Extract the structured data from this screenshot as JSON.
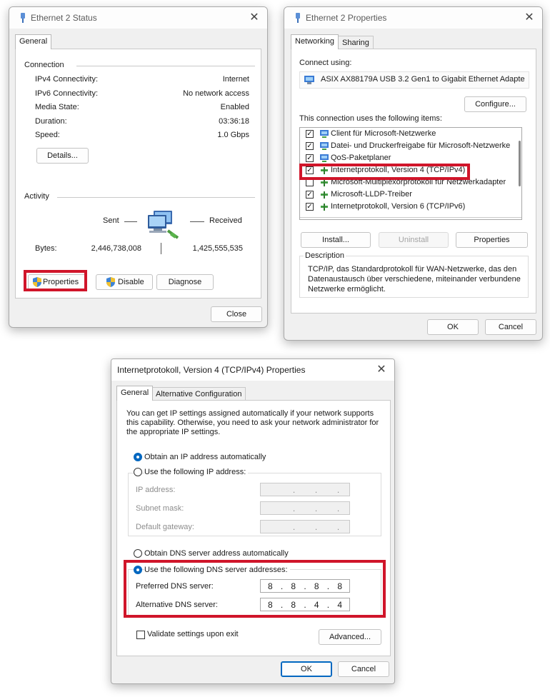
{
  "status_window": {
    "title": "Ethernet 2 Status",
    "tab_general": "General",
    "connection_heading": "Connection",
    "rows": [
      {
        "label": "IPv4 Connectivity:",
        "value": "Internet"
      },
      {
        "label": "IPv6 Connectivity:",
        "value": "No network access"
      },
      {
        "label": "Media State:",
        "value": "Enabled"
      },
      {
        "label": "Duration:",
        "value": "03:36:18"
      },
      {
        "label": "Speed:",
        "value": "1.0 Gbps"
      }
    ],
    "details_button": "Details...",
    "activity_heading": "Activity",
    "sent_label": "Sent",
    "received_label": "Received",
    "bytes_label": "Bytes:",
    "bytes_sent": "2,446,738,008",
    "bytes_received": "1,425,555,535",
    "properties_button": "Properties",
    "disable_button": "Disable",
    "diagnose_button": "Diagnose",
    "close_button": "Close"
  },
  "properties_window": {
    "title": "Ethernet 2 Properties",
    "tab_networking": "Networking",
    "tab_sharing": "Sharing",
    "connect_using_label": "Connect using:",
    "adapter_name": "ASIX AX88179A USB 3.2 Gen1 to Gigabit Ethernet Adapte",
    "configure_button": "Configure...",
    "items_label": "This connection uses the following items:",
    "items": [
      {
        "label": "Client für Microsoft-Netzwerke",
        "checked": true,
        "icon": "network-client-icon"
      },
      {
        "label": "Datei- und Druckerfreigabe für Microsoft-Netzwerke",
        "checked": true,
        "icon": "file-share-icon"
      },
      {
        "label": "QoS-Paketplaner",
        "checked": true,
        "icon": "qos-icon"
      },
      {
        "label": "Internetprotokoll, Version 4 (TCP/IPv4)",
        "checked": true,
        "icon": "protocol-icon"
      },
      {
        "label": "Microsoft-Multiplexorprotokoll für Netzwerkadapter",
        "checked": false,
        "icon": "protocol-icon"
      },
      {
        "label": "Microsoft-LLDP-Treiber",
        "checked": true,
        "icon": "protocol-icon"
      },
      {
        "label": "Internetprotokoll, Version 6 (TCP/IPv6)",
        "checked": true,
        "icon": "protocol-icon"
      }
    ],
    "install_button": "Install...",
    "uninstall_button": "Uninstall",
    "properties_button": "Properties",
    "description_heading": "Description",
    "description_text": "TCP/IP, das Standardprotokoll für WAN-Netzwerke, das den Datenaustausch über verschiedene, miteinander verbundene Netzwerke ermöglicht.",
    "ok_button": "OK",
    "cancel_button": "Cancel"
  },
  "ipv4_window": {
    "title": "Internetprotokoll, Version 4 (TCP/IPv4) Properties",
    "tab_general": "General",
    "tab_alternative": "Alternative Configuration",
    "intro_text": "You can get IP settings assigned automatically if your network supports this capability. Otherwise, you need to ask your network administrator for the appropriate IP settings.",
    "radio_obtain_ip": "Obtain an IP address automatically",
    "radio_use_ip": "Use the following IP address:",
    "ip_address_label": "IP address:",
    "subnet_mask_label": "Subnet mask:",
    "default_gateway_label": "Default gateway:",
    "radio_obtain_dns": "Obtain DNS server address automatically",
    "radio_use_dns": "Use the following DNS server addresses:",
    "preferred_dns_label": "Preferred DNS server:",
    "alternative_dns_label": "Alternative DNS server:",
    "preferred_dns": [
      "8",
      "8",
      "8",
      "8"
    ],
    "alternative_dns": [
      "8",
      "8",
      "4",
      "4"
    ],
    "validate_label": "Validate settings upon exit",
    "advanced_button": "Advanced...",
    "ok_button": "OK",
    "cancel_button": "Cancel"
  },
  "colors": {
    "highlight_box": "#d0152a",
    "accent": "#0067c0"
  }
}
